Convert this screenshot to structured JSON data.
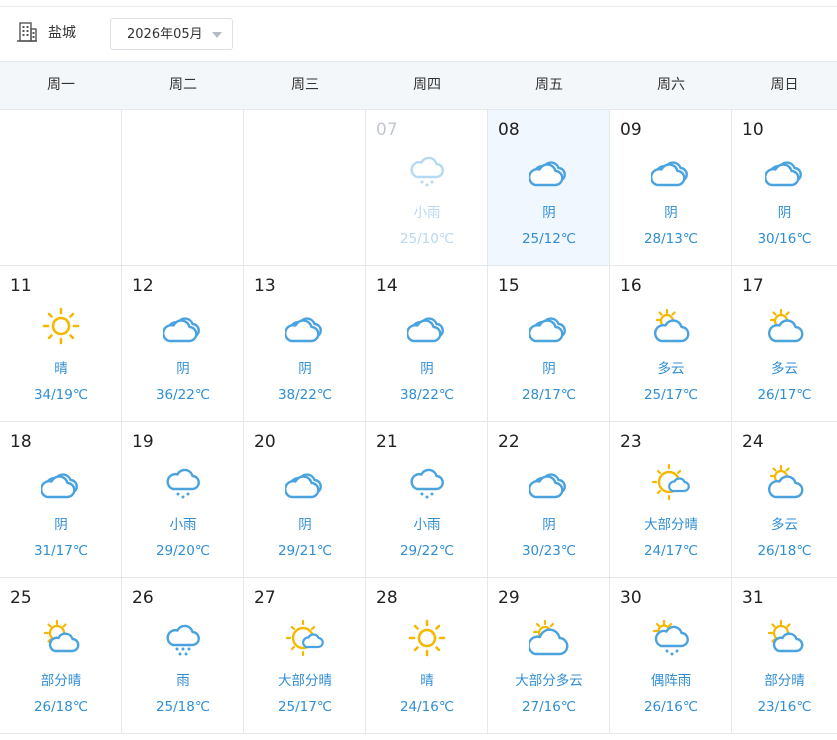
{
  "toolbar": {
    "city": "盐城",
    "month": "2026年05月"
  },
  "weekdays": [
    "周一",
    "周二",
    "周三",
    "周四",
    "周五",
    "周六",
    "周日"
  ],
  "days": [
    {
      "day": "07",
      "cond": "小雨",
      "temp": "25/10℃",
      "icon": "light-rain-icon",
      "state": "past"
    },
    {
      "day": "08",
      "cond": "阴",
      "temp": "25/12℃",
      "icon": "overcast-icon",
      "state": "selected"
    },
    {
      "day": "09",
      "cond": "阴",
      "temp": "28/13℃",
      "icon": "overcast-icon",
      "state": ""
    },
    {
      "day": "10",
      "cond": "阴",
      "temp": "30/16℃",
      "icon": "overcast-icon",
      "state": ""
    },
    {
      "day": "11",
      "cond": "晴",
      "temp": "34/19℃",
      "icon": "sunny-icon",
      "state": ""
    },
    {
      "day": "12",
      "cond": "阴",
      "temp": "36/22℃",
      "icon": "overcast-icon",
      "state": ""
    },
    {
      "day": "13",
      "cond": "阴",
      "temp": "38/22℃",
      "icon": "overcast-icon",
      "state": ""
    },
    {
      "day": "14",
      "cond": "阴",
      "temp": "38/22℃",
      "icon": "overcast-icon",
      "state": ""
    },
    {
      "day": "15",
      "cond": "阴",
      "temp": "28/17℃",
      "icon": "overcast-icon",
      "state": ""
    },
    {
      "day": "16",
      "cond": "多云",
      "temp": "25/17℃",
      "icon": "cloudy-icon",
      "state": ""
    },
    {
      "day": "17",
      "cond": "多云",
      "temp": "26/17℃",
      "icon": "cloudy-icon",
      "state": ""
    },
    {
      "day": "18",
      "cond": "阴",
      "temp": "31/17℃",
      "icon": "overcast-icon",
      "state": ""
    },
    {
      "day": "19",
      "cond": "小雨",
      "temp": "29/20℃",
      "icon": "light-rain-icon",
      "state": ""
    },
    {
      "day": "20",
      "cond": "阴",
      "temp": "29/21℃",
      "icon": "overcast-icon",
      "state": ""
    },
    {
      "day": "21",
      "cond": "小雨",
      "temp": "29/22℃",
      "icon": "light-rain-icon",
      "state": ""
    },
    {
      "day": "22",
      "cond": "阴",
      "temp": "30/23℃",
      "icon": "overcast-icon",
      "state": ""
    },
    {
      "day": "23",
      "cond": "大部分晴",
      "temp": "24/17℃",
      "icon": "mostly-sunny-icon",
      "state": ""
    },
    {
      "day": "24",
      "cond": "多云",
      "temp": "26/18℃",
      "icon": "cloudy-icon",
      "state": ""
    },
    {
      "day": "25",
      "cond": "部分晴",
      "temp": "26/18℃",
      "icon": "partly-sunny-icon",
      "state": ""
    },
    {
      "day": "26",
      "cond": "雨",
      "temp": "25/18℃",
      "icon": "rain-icon",
      "state": ""
    },
    {
      "day": "27",
      "cond": "大部分晴",
      "temp": "25/17℃",
      "icon": "mostly-sunny-icon",
      "state": ""
    },
    {
      "day": "28",
      "cond": "晴",
      "temp": "24/16℃",
      "icon": "sunny-icon",
      "state": ""
    },
    {
      "day": "29",
      "cond": "大部分多云",
      "temp": "27/16℃",
      "icon": "mostly-cloudy-icon",
      "state": ""
    },
    {
      "day": "30",
      "cond": "偶阵雨",
      "temp": "26/16℃",
      "icon": "showers-icon",
      "state": ""
    },
    {
      "day": "31",
      "cond": "部分晴",
      "temp": "23/16℃",
      "icon": "partly-sunny-icon",
      "state": ""
    }
  ],
  "colors": {
    "accent": "#2f8ed4",
    "cloud": "#4aa3df",
    "sun": "#f5b800",
    "selected_bg": "#f0f7ff",
    "header_bg": "#f4f7fa",
    "border": "#e4e8ee"
  }
}
